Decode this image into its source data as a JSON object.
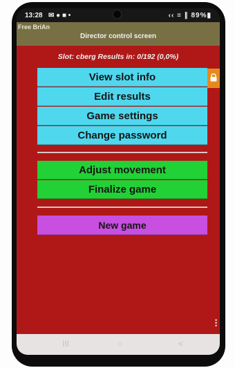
{
  "status_bar": {
    "time": "13:28",
    "notification_icons": "✉ ● ■ •",
    "system_icons": "‹‹ ≡ ∥ 89%▮",
    "battery": "89%"
  },
  "app": {
    "name": "Free BriAn",
    "screen_title": "Director control screen"
  },
  "info": {
    "text": "Slot: cberg   Results in: 0/192 (0,0%)"
  },
  "menu": {
    "view_slot_info": "View slot info",
    "edit_results": "Edit results",
    "game_settings": "Game settings",
    "change_password": "Change password",
    "adjust_movement": "Adjust movement",
    "finalize_game": "Finalize game",
    "new_game": "New game"
  },
  "navigation": {
    "recents": "III",
    "home": "○",
    "back": "<"
  },
  "colors": {
    "background": "#b01818",
    "cyan_buttons": "#4fd7ee",
    "green_buttons": "#22d135",
    "purple_button": "#c84fe0",
    "lock_badge": "#e68a1f",
    "app_bar": "#787044"
  },
  "icons": {
    "lock": "lock-icon",
    "overflow": "overflow-menu-icon"
  }
}
